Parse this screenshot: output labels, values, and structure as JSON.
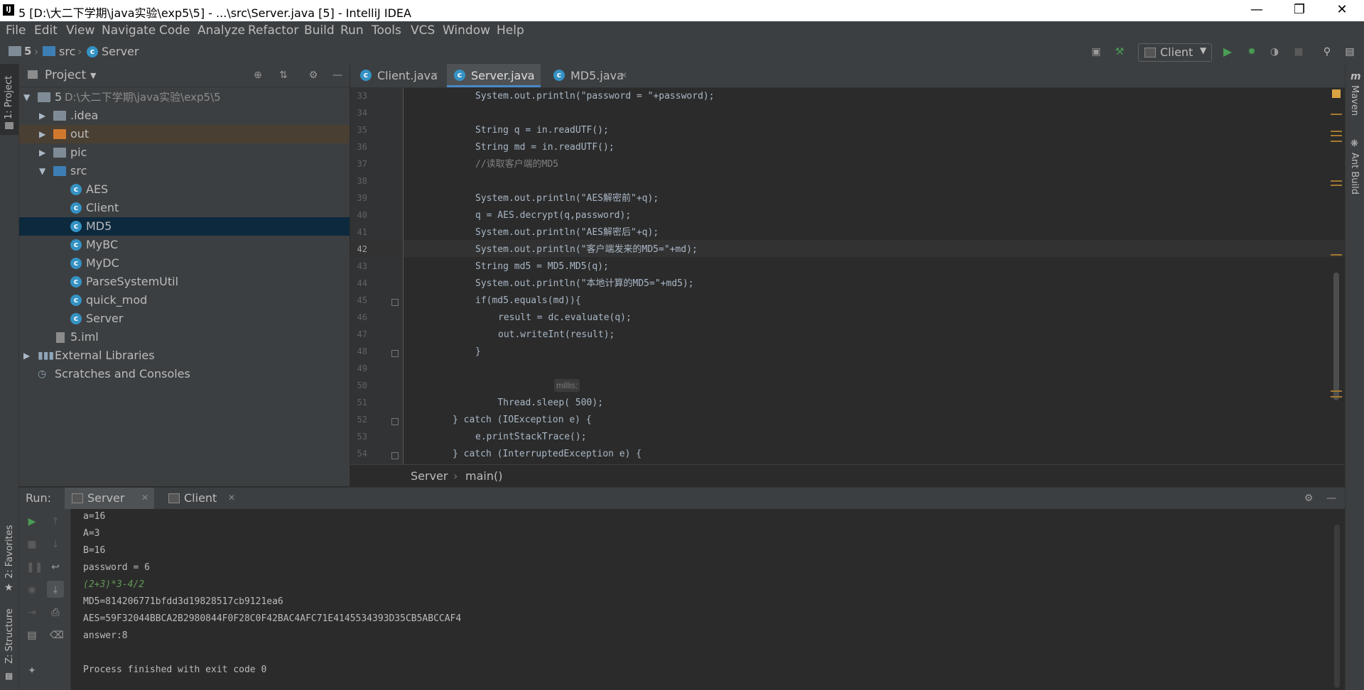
{
  "window": {
    "title": "5 [D:\\大二下学期\\java实验\\exp5\\5] - ...\\src\\Server.java [5] - IntelliJ IDEA",
    "logo": "IJ",
    "controls": [
      "minimize-icon",
      "restore-icon",
      "close-icon"
    ]
  },
  "menu": [
    "File",
    "Edit",
    "View",
    "Navigate",
    "Code",
    "Analyze",
    "Refactor",
    "Build",
    "Run",
    "Tools",
    "VCS",
    "Window",
    "Help"
  ],
  "navbar": {
    "crumbs": [
      "5",
      "src",
      "Server"
    ],
    "run_config": "Client"
  },
  "left_stripe": {
    "project": "1: Project",
    "favorites": "2: Favorites",
    "structure": "Z: Structure"
  },
  "right_stripe": {
    "maven": "Maven",
    "ant": "Ant Build"
  },
  "project": {
    "header": "Project",
    "root_name": "5",
    "root_path": "D:\\大二下学期\\java实验\\exp5\\5",
    "items": [
      {
        "label": ".idea",
        "kind": "folder"
      },
      {
        "label": "out",
        "kind": "folder-out"
      },
      {
        "label": "pic",
        "kind": "folder"
      },
      {
        "label": "src",
        "kind": "folder-src"
      },
      {
        "label": "AES",
        "kind": "class"
      },
      {
        "label": "Client",
        "kind": "class"
      },
      {
        "label": "MD5",
        "kind": "class",
        "selected": true
      },
      {
        "label": "MyBC",
        "kind": "class"
      },
      {
        "label": "MyDC",
        "kind": "class"
      },
      {
        "label": "ParseSystemUtil",
        "kind": "class"
      },
      {
        "label": "quick_mod",
        "kind": "class"
      },
      {
        "label": "Server",
        "kind": "class"
      },
      {
        "label": "5.iml",
        "kind": "file"
      },
      {
        "label": "External Libraries",
        "kind": "lib"
      },
      {
        "label": "Scratches and Consoles",
        "kind": "scratch"
      }
    ]
  },
  "editor": {
    "tabs": [
      "Client.java",
      "Server.java",
      "MD5.java"
    ],
    "active_tab": "Server.java",
    "line_numbers": [
      "33",
      "34",
      "35",
      "36",
      "37",
      "38",
      "39",
      "40",
      "41",
      "42",
      "43",
      "44",
      "45",
      "46",
      "47",
      "48",
      "49",
      "50",
      "51",
      "52",
      "53",
      "54"
    ],
    "code": {
      "l33": "System.out.println(\"password = \"+password);",
      "l35": "String q = in.readUTF();",
      "l36": "String md = in.readUTF();",
      "l37": "//读取客户端的MD5",
      "l39": "System.out.println(\"AES解密前\"+q);",
      "l40": "q = AES.decrypt(q,password);",
      "l41": "System.out.println(\"AES解密后\"+q);",
      "l42": "System.out.println(\"客户端发来的MD5=\"+md);",
      "l43": "String md5 = MD5.MD5(q);",
      "l44": "System.out.println(\"本地计算的MD5=\"+md5);",
      "l45": "if(md5.equals(md)){",
      "l46": "result = dc.evaluate(q);",
      "l47": "out.writeInt(result);",
      "l48": "}",
      "l50_hint": "millis:",
      "l50": "Thread.sleep( 500);",
      "l52": "} catch (IOException e) {",
      "l53": "e.printStackTrace();",
      "l54": "} catch (InterruptedException e) {"
    },
    "breadcrumb": [
      "Server",
      "main()"
    ]
  },
  "run": {
    "label": "Run:",
    "tabs": [
      "Server",
      "Client"
    ],
    "output": [
      "a=16",
      "A=3",
      "B=16",
      "password = 6",
      "(2+3)*3-4/2",
      "MD5=814206771bfdd3d19828517cb9121ea6",
      "AES=59F32044BBCA2B2980844F0F28C0F42BAC4AFC71E4145534393D35CB5ABCCAF4",
      "answer:8",
      "",
      "Process finished with exit code 0"
    ]
  }
}
